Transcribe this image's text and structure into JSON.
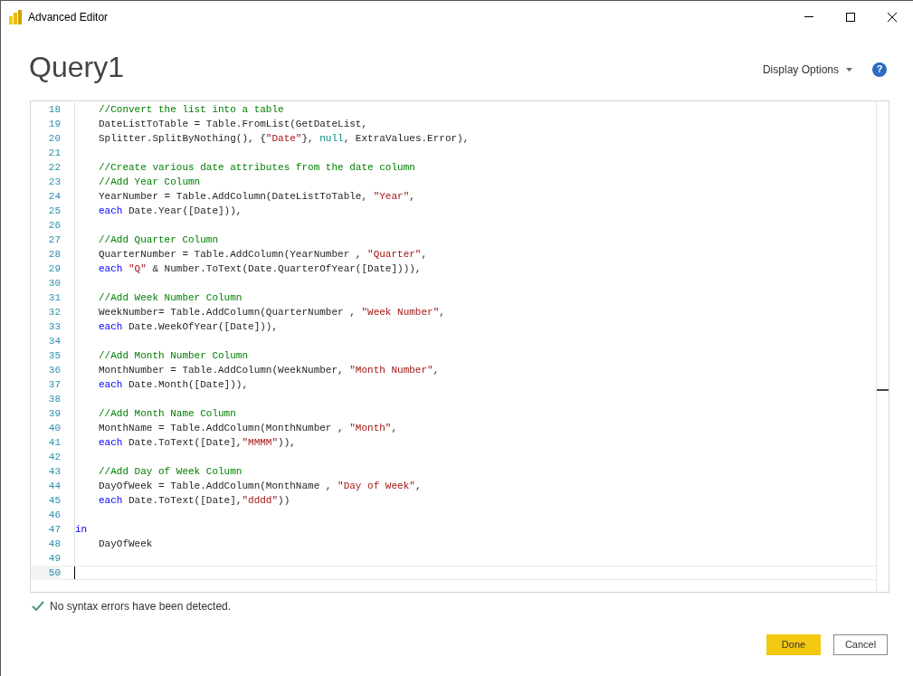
{
  "window": {
    "title": "Advanced Editor"
  },
  "query_title": "Query1",
  "display_options": {
    "label": "Display Options"
  },
  "help": {
    "label": "?"
  },
  "editor": {
    "lines": [
      {
        "number": "18",
        "indented": true,
        "current": false,
        "tokens": [
          {
            "kind": "comment",
            "text": "//Convert the list into a table"
          }
        ]
      },
      {
        "number": "19",
        "indented": true,
        "current": false,
        "tokens": [
          {
            "kind": "plain",
            "text": "DateListToTable = Table.FromList(GetDateList,"
          }
        ]
      },
      {
        "number": "20",
        "indented": true,
        "current": false,
        "tokens": [
          {
            "kind": "plain",
            "text": "Splitter.SplitByNothing(), {"
          },
          {
            "kind": "string",
            "text": "\"Date\""
          },
          {
            "kind": "plain",
            "text": "}, "
          },
          {
            "kind": "constant",
            "text": "null"
          },
          {
            "kind": "plain",
            "text": ", ExtraValues.Error),"
          }
        ]
      },
      {
        "number": "21",
        "current": false
      },
      {
        "number": "22",
        "indented": true,
        "current": false,
        "tokens": [
          {
            "kind": "comment",
            "text": "//Create various date attributes from the date column"
          }
        ]
      },
      {
        "number": "23",
        "indented": true,
        "current": false,
        "tokens": [
          {
            "kind": "comment",
            "text": "//Add Year Column"
          }
        ]
      },
      {
        "number": "24",
        "indented": true,
        "current": false,
        "tokens": [
          {
            "kind": "plain",
            "text": "YearNumber = Table.AddColumn(DateListToTable, "
          },
          {
            "kind": "string",
            "text": "\"Year\""
          },
          {
            "kind": "plain",
            "text": ","
          }
        ]
      },
      {
        "number": "25",
        "indented": true,
        "current": false,
        "tokens": [
          {
            "kind": "keyword",
            "text": "each"
          },
          {
            "kind": "plain",
            "text": " Date.Year([Date])),"
          }
        ]
      },
      {
        "number": "26",
        "current": false
      },
      {
        "number": "27",
        "indented": true,
        "current": false,
        "tokens": [
          {
            "kind": "comment",
            "text": "//Add Quarter Column"
          }
        ]
      },
      {
        "number": "28",
        "indented": true,
        "current": false,
        "tokens": [
          {
            "kind": "plain",
            "text": "QuarterNumber = Table.AddColumn(YearNumber , "
          },
          {
            "kind": "string",
            "text": "\"Quarter\""
          },
          {
            "kind": "plain",
            "text": ","
          }
        ]
      },
      {
        "number": "29",
        "indented": true,
        "current": false,
        "tokens": [
          {
            "kind": "keyword",
            "text": "each"
          },
          {
            "kind": "string",
            "text": "\"Q\"",
            "space_before": true
          },
          {
            "kind": "plain",
            "text": " & Number.ToText(Date.QuarterOfYear([Date]))),"
          }
        ]
      },
      {
        "number": "30",
        "current": false
      },
      {
        "number": "31",
        "indented": true,
        "current": false,
        "tokens": [
          {
            "kind": "comment",
            "text": "//Add Week Number Column"
          }
        ]
      },
      {
        "number": "32",
        "indented": true,
        "current": false,
        "tokens": [
          {
            "kind": "plain",
            "text": "WeekNumber= Table.AddColumn(QuarterNumber , "
          },
          {
            "kind": "string",
            "text": "\"Week Number\""
          },
          {
            "kind": "plain",
            "text": ","
          }
        ]
      },
      {
        "number": "33",
        "indented": true,
        "current": false,
        "tokens": [
          {
            "kind": "keyword",
            "text": "each"
          },
          {
            "kind": "plain",
            "text": " Date.WeekOfYear([Date])),"
          }
        ]
      },
      {
        "number": "34",
        "current": false
      },
      {
        "number": "35",
        "indented": true,
        "current": false,
        "tokens": [
          {
            "kind": "comment",
            "text": "//Add Month Number Column"
          }
        ]
      },
      {
        "number": "36",
        "indented": true,
        "current": false,
        "tokens": [
          {
            "kind": "plain",
            "text": "MonthNumber = Table.AddColumn(WeekNumber, "
          },
          {
            "kind": "string",
            "text": "\"Month Number\""
          },
          {
            "kind": "plain",
            "text": ","
          }
        ]
      },
      {
        "number": "37",
        "indented": true,
        "current": false,
        "tokens": [
          {
            "kind": "keyword",
            "text": "each"
          },
          {
            "kind": "plain",
            "text": " Date.Month([Date])),"
          }
        ]
      },
      {
        "number": "38",
        "current": false
      },
      {
        "number": "39",
        "indented": true,
        "current": false,
        "tokens": [
          {
            "kind": "comment",
            "text": "//Add Month Name Column"
          }
        ]
      },
      {
        "number": "40",
        "indented": true,
        "current": false,
        "tokens": [
          {
            "kind": "plain",
            "text": "MonthName = Table.AddColumn(MonthNumber , "
          },
          {
            "kind": "string",
            "text": "\"Month\""
          },
          {
            "kind": "plain",
            "text": ","
          }
        ]
      },
      {
        "number": "41",
        "indented": true,
        "current": false,
        "tokens": [
          {
            "kind": "keyword",
            "text": "each"
          },
          {
            "kind": "plain",
            "text": " Date.ToText([Date],"
          },
          {
            "kind": "string",
            "text": "\"MMMM\""
          },
          {
            "kind": "plain",
            "text": ")),"
          }
        ]
      },
      {
        "number": "42",
        "current": false
      },
      {
        "number": "43",
        "indented": true,
        "current": false,
        "tokens": [
          {
            "kind": "comment",
            "text": "//Add Day of Week Column"
          }
        ]
      },
      {
        "number": "44",
        "indented": true,
        "current": false,
        "tokens": [
          {
            "kind": "plain",
            "text": "DayOfWeek = Table.AddColumn(MonthName , "
          },
          {
            "kind": "string",
            "text": "\"Day of Week\""
          },
          {
            "kind": "plain",
            "text": ","
          }
        ]
      },
      {
        "number": "45",
        "indented": true,
        "current": false,
        "tokens": [
          {
            "kind": "keyword",
            "text": "each"
          },
          {
            "kind": "plain",
            "text": " Date.ToText([Date],"
          },
          {
            "kind": "string",
            "text": "\"dddd\""
          },
          {
            "kind": "plain",
            "text": "))"
          }
        ]
      },
      {
        "number": "46",
        "current": false
      },
      {
        "number": "47",
        "indented": false,
        "current": false,
        "tokens": [
          {
            "kind": "keyword",
            "text": "in"
          }
        ]
      },
      {
        "number": "48",
        "indented": true,
        "current": false,
        "tokens": [
          {
            "kind": "plain",
            "text": "DayOfWeek"
          }
        ]
      },
      {
        "number": "49",
        "current": false
      },
      {
        "number": "50",
        "current": true
      }
    ]
  },
  "status": {
    "ok": true,
    "message": "No syntax errors have been detected."
  },
  "buttons": [
    {
      "label": "Done",
      "primary": true
    },
    {
      "label": "Cancel",
      "primary": false
    }
  ]
}
